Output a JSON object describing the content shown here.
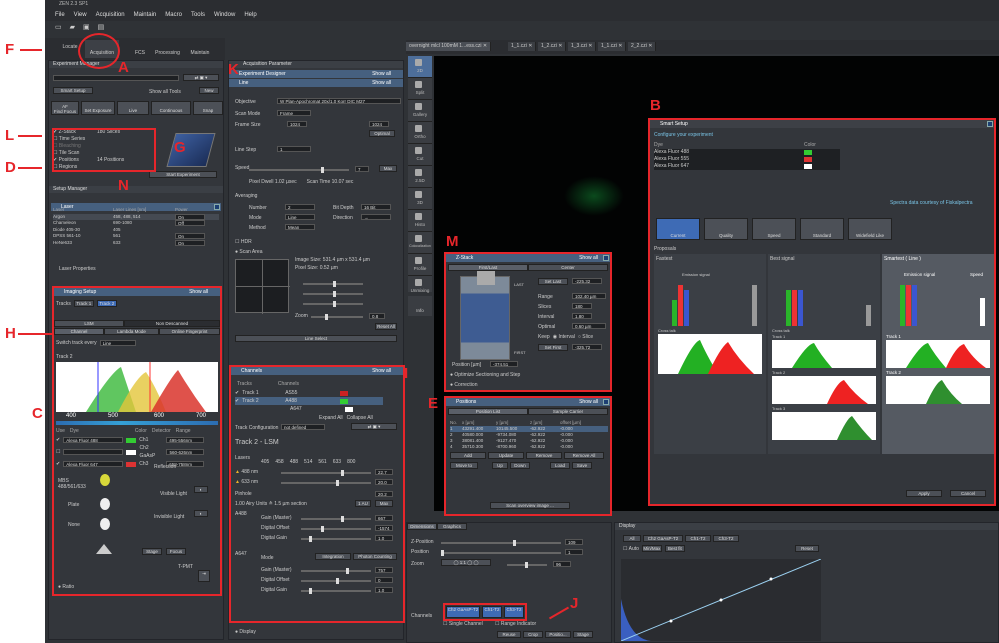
{
  "app": {
    "title": "ZEN 2.3 SP1",
    "menu": [
      "File",
      "View",
      "Acquisition",
      "Maintain",
      "Macro",
      "Tools",
      "Window",
      "Help"
    ]
  },
  "main_tabs": [
    "Locate",
    "Acquisition",
    "FCS",
    "Processing",
    "Maintain"
  ],
  "experiment_manager": {
    "title": "Experiment Manager",
    "smart_setup": "Smart Setup",
    "show_all_tools": "Show all Tools",
    "new": "New"
  },
  "toolbar": {
    "find_focus": "Find Focus",
    "af": "AF",
    "set_exposure": "Set Exposure",
    "live": "Live",
    "continuous": "Continuous",
    "snap": "Snap"
  },
  "dims": [
    {
      "label": "Z-Stack",
      "value": "180 Slices",
      "checked": true
    },
    {
      "label": "Time Series",
      "value": "",
      "checked": false
    },
    {
      "label": "Bleaching",
      "value": "",
      "checked": false
    },
    {
      "label": "Tile Scan",
      "value": "",
      "checked": false
    },
    {
      "label": "Positions",
      "value": "14 Positions",
      "checked": true
    },
    {
      "label": "Regions",
      "value": "",
      "checked": false
    }
  ],
  "start_experiment": "Start Experiment",
  "setup_manager": "Setup Manager",
  "laser": {
    "title": "Laser",
    "headers": [
      "Laser",
      "Laser Lines [nm]",
      "Power"
    ],
    "rows": [
      [
        "Argon",
        "458, 488, 514",
        "On"
      ],
      [
        "Chameleon",
        "690-1080",
        "Off"
      ],
      [
        "Diode 405-30",
        "405",
        ""
      ],
      [
        "DPSS 561-10",
        "561",
        "On"
      ],
      [
        "HeNe633",
        "633",
        "On"
      ]
    ],
    "props": "Laser Properties"
  },
  "imaging": {
    "title": "Imaging Setup",
    "tracks_label": "Tracks",
    "track1": "Track 1",
    "track2": "Track 2",
    "lsm": "LSM",
    "non_descanned": "Non Descanned",
    "channel": "Channel",
    "lambda": "Lambda Mode",
    "online": "Online Fingerprint",
    "switch": "Switch track every",
    "switch_val": "Line",
    "track_title": "Track 2",
    "axis": [
      "400",
      "500",
      "600",
      "700"
    ],
    "dye_headers": [
      "Use",
      "Dye",
      "Color",
      "Detector",
      "Range"
    ],
    "dyes": [
      [
        "Alexa Fluor 488",
        "Ch1",
        "495-556nm"
      ],
      [
        "",
        "Ch2 GaAsP",
        "560-626nm"
      ],
      [
        "Alexa Fluor 647",
        "Ch3",
        "658-758nm"
      ]
    ],
    "reflection": "Reflection",
    "mbs": "MBS",
    "mbs_val": "488/561/633",
    "plate": "Plate",
    "none": "None",
    "visible": "Visible Light",
    "invisible": "Invisible Light",
    "stage": "Stage",
    "focus": "Focus",
    "tpmt": "T-PMT",
    "ratio": "Ratio"
  },
  "acq": {
    "title": "Acquisition Parameter",
    "designer": "Experiment Designer",
    "mode": "Line",
    "show_all": "Show all",
    "objective_l": "Objective",
    "objective": "W Plan-Apochromat 20x/1.0 Korr DIC M27",
    "scan_mode_l": "Scan Mode",
    "scan_mode": "Frame",
    "frame_size_l": "Frame Size",
    "x": "1024",
    "y": "1024",
    "optimal": "Optimal",
    "line_step_l": "Line Step",
    "line_step": "1",
    "speed_l": "Speed",
    "speed": "7",
    "max": "Max",
    "pixel_dwell": "Pixel Dwell  1.02 µsec",
    "scan_time": "Scan Time  10.07 sec",
    "averaging": "Averaging",
    "number_l": "Number",
    "number": "2",
    "bit_depth_l": "Bit Depth",
    "bit_depth": "16 Bit",
    "mode_l": "Mode",
    "direction_l": "Direction",
    "method_l": "Method",
    "method": "Mean",
    "hdr": "HDR",
    "scan_area": "Scan Area",
    "image_size": "Image Size:  531.4 µm x 531.4 µm",
    "pixel_size": "Pixel Size:  0.52 µm",
    "zoom_l": "Zoom",
    "zoom": "0.8",
    "reset": "Reset All",
    "line_select": "Line Select"
  },
  "channels": {
    "title": "Channels",
    "show_all": "Show all",
    "headers": [
      "Tracks",
      "Channels"
    ],
    "tracks": [
      "Track 1",
      "Track 2"
    ],
    "channels": [
      "AS55",
      "A488",
      "A647"
    ],
    "expand": "Expand All",
    "collapse": "Collapse All",
    "config_l": "Track Configuration",
    "config": "not defined",
    "track_title": "Track 2 - LSM",
    "lasers_l": "Lasers",
    "wavelengths": [
      "405",
      "458",
      "488",
      "514",
      "561",
      "633",
      "800"
    ],
    "l1": "488 nm",
    "l1v": "22.7",
    "l2": "633 nm",
    "l2v": "20.0",
    "pinhole_l": "Pinhole",
    "pinhole": "20.2",
    "airy": "1.00 Airy Units  ≙  1.5 µm section",
    "airy_btn": "1 AU",
    "max": "Max",
    "a488": "A488",
    "a647": "A647",
    "gain_l": "Gain (Master)",
    "gain1": "667",
    "offset_l": "Digital Offset",
    "offset1": "-1574",
    "dgain_l": "Digital Gain",
    "dgain1": "1.0",
    "mode_l": "Mode",
    "integration": "Integration",
    "photon": "Photon Counting",
    "gain2": "757",
    "offset2": "0",
    "dgain2": "1.0",
    "display": "Display"
  },
  "image_tabs": [
    "overnight mlcl 100mM 1...ess.czi",
    "1_1.czi",
    "1_2.czi",
    "1_3.czi",
    "1_1.czi",
    "2_2.czi"
  ],
  "view_tabs": [
    "2D",
    "Split",
    "Gallery",
    "Ortho",
    "Cut",
    "2.5D",
    "3D",
    "Histo",
    "Colocalization",
    "Profile",
    "Unmixing",
    "Info"
  ],
  "zstack": {
    "title": "Z-Stack",
    "show_all": "Show all",
    "first_last": "First/Last",
    "center": "Center",
    "set_last": "Set Last",
    "last_val": "-225.32",
    "range_l": "Range",
    "range": "102.40 µm",
    "slices_l": "Slices",
    "slices": "180",
    "interval_l": "Interval",
    "interval": "1.80",
    "optimal_l": "Optimal",
    "optimal": "0.60 µm",
    "keep_l": "Keep",
    "interval_opt": "Interval",
    "slice_opt": "Slice",
    "set_first": "Set First",
    "first_val": "-325.72",
    "position": "Position [µm]",
    "position_val": "-374.51",
    "optimize": "Optimize Sectioning and Step",
    "correction": "Correction",
    "last_lbl": "LAST",
    "first_lbl": "FIRST"
  },
  "positions": {
    "title": "Positions",
    "show_all": "Show all",
    "list": "Position List",
    "carrier": "Sample Carrier",
    "headers": [
      "No.",
      "x [µm]",
      "y [µm]",
      "z [µm]",
      "offset [µm]"
    ],
    "rows": [
      [
        "1",
        "43291.400",
        "10145.500",
        "-62.922",
        "-0.000"
      ],
      [
        "2",
        "40580.000",
        "-9734.080",
        "-62.922",
        "-0.000"
      ],
      [
        "3",
        "38081.400",
        "-9127.470",
        "-62.922",
        "-0.000"
      ],
      [
        "4",
        "35710.300",
        "-8700.960",
        "-62.922",
        "-0.000"
      ]
    ],
    "add": "Add",
    "update": "Update",
    "remove": "Remove",
    "remove_all": "Remove All",
    "move_to": "Move to",
    "up": "Up",
    "down": "Down",
    "load": "Load",
    "save": "Save",
    "scan": "Scan overview image ..."
  },
  "smart": {
    "title": "Smart Setup",
    "configure": "Configure your experiment",
    "dye_l": "Dye",
    "color_l": "Color",
    "dyes": [
      "Alexa Fluor 488",
      "Alexa Fluor 555",
      "Alexa Fluor 647"
    ],
    "spectra": "Spectra data courtesy of Fiskalpectra",
    "modes": [
      "Current",
      "Quality",
      "Speed",
      "Standard",
      "Widefield Like"
    ],
    "proposals": "Proposals",
    "p1": "Fastest",
    "p2": "Best signal",
    "p3": "Smartest ( Line )",
    "emission": "Emission signal",
    "speed": "Speed",
    "cross": "Cross talk",
    "t1": "Track 1",
    "t2": "Track 2",
    "t3": "Track 3",
    "pct": [
      "90 %",
      "70 %",
      "50 %",
      "30 %",
      "10 %",
      "0 %"
    ],
    "apply": "Apply",
    "cancel": "Cancel"
  },
  "bottom": {
    "tabs": [
      "Dimensions",
      "Graphics"
    ],
    "zpos": "Z-Position",
    "position": "Position",
    "zoom": "Zoom",
    "zpos_val": "109",
    "pos_val": "1",
    "zoom_val": "96",
    "channels_l": "Channels",
    "ch": [
      "Ch2 GaAsP-T2",
      "Ch1-T2",
      "Ch3-T2"
    ],
    "single": "Single Channel",
    "range": "Range Indicator",
    "reuse": "Reuse",
    "crop": "Crop",
    "positio": "Positio...",
    "stage": "Stage"
  },
  "display": {
    "title": "Display",
    "tabs": [
      "All",
      "Ch2 GaAsP-T2",
      "Ch1-T2",
      "Ch3-T2"
    ],
    "auto": "Auto",
    "minmax": "Min/Max",
    "bestfit": "Best fit",
    "reset": "Reset"
  },
  "labels": [
    "A",
    "B",
    "C",
    "D",
    "E",
    "F",
    "G",
    "H",
    "I",
    "J",
    "K",
    "L",
    "M",
    "N"
  ]
}
